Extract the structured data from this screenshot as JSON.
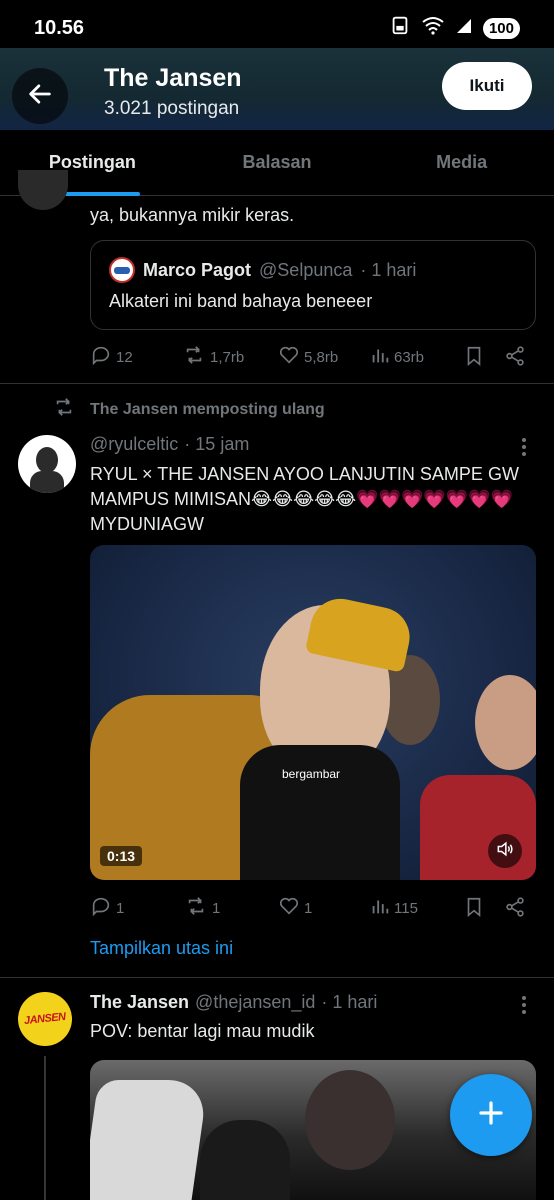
{
  "status_bar": {
    "time": "10.56",
    "battery": "100"
  },
  "header": {
    "title": "The Jansen",
    "subtitle": "3.021 postingan",
    "follow_label": "Ikuti"
  },
  "tabs": [
    {
      "label": "Postingan",
      "active": true
    },
    {
      "label": "Balasan",
      "active": false
    },
    {
      "label": "Media",
      "active": false
    }
  ],
  "post1": {
    "text": "ya, bukannya mikir keras.",
    "quote": {
      "name": "Marco Pagot",
      "handle": "@Selpunca",
      "time": "· 1 hari",
      "text": "Alkateri ini band bahaya beneeer"
    },
    "stats": {
      "replies": "12",
      "reposts": "1,7rb",
      "likes": "5,8rb",
      "views": "63rb"
    }
  },
  "post2": {
    "repost_label": "The Jansen memposting ulang",
    "handle": "@ryulceltic",
    "time": "· 15 jam",
    "text": "RYUL × THE JANSEN AYOO LANJUTIN SAMPE GW MAMPUS MIMISAN😂😂😂😂😂💗💗💗💗💗💗💗 MYDUNIAGW",
    "video": {
      "label": "bergambar",
      "duration": "0:13"
    },
    "stats": {
      "replies": "1",
      "reposts": "1",
      "likes": "1",
      "views": "115"
    },
    "show_thread": "Tampilkan utas ini"
  },
  "post3": {
    "name": "The Jansen",
    "handle": "@thejansen_id",
    "time": "· 1 hari",
    "text": "POV: bentar lagi mau mudik",
    "avatar_text": "JANSEN"
  },
  "colors": {
    "accent": "#1d9bf0",
    "background": "#000000",
    "muted": "#71767b"
  }
}
